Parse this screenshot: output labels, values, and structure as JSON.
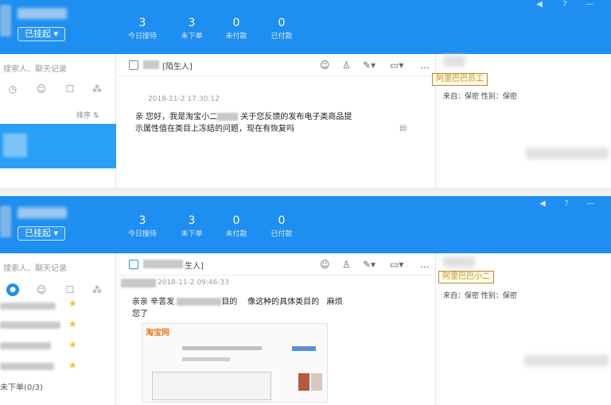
{
  "panels": [
    {
      "header": {
        "status_label": "已挂起 ▾",
        "stats": [
          {
            "value": "3",
            "label": "今日接待"
          },
          {
            "value": "3",
            "label": "未下单"
          },
          {
            "value": "0",
            "label": "未付款"
          },
          {
            "value": "0",
            "label": "已付款"
          }
        ]
      },
      "sidebar": {
        "search_placeholder": "搜索人、聊天记录",
        "sort_label": "排序 ⇅"
      },
      "chat": {
        "contact_tag": "陌生人",
        "message": {
          "time": "2018-11-2 17:30:12",
          "line1_a": "亲  您好，我是淘宝小二",
          "line1_b": "关于您反馈的发布电子类商品提",
          "line2": "示属性值在类目上冻结的问题，现在有恢复吗"
        }
      },
      "profile": {
        "nickname": "阿里巴巴员工",
        "info": "来自：保密   性别：保密"
      }
    },
    {
      "header": {
        "status_label": "已挂起 ▾",
        "stats": [
          {
            "value": "3",
            "label": "今日接待"
          },
          {
            "value": "3",
            "label": "未下单"
          },
          {
            "value": "0",
            "label": "未付款"
          },
          {
            "value": "0",
            "label": "已付款"
          }
        ]
      },
      "sidebar": {
        "search_placeholder": "搜索人、聊天记录",
        "order_label": "未下单(0/3)"
      },
      "chat": {
        "contact_tag": "生人",
        "message": {
          "time": "2018-11-2 09:46:33",
          "line1_a": "亲亲  辛苦发",
          "line1_b": "目的",
          "line1_c": "像这种的具体类目的",
          "line1_d": "麻烦",
          "line2": "您了",
          "screenshot_caption": "淘宝网"
        }
      },
      "profile": {
        "nickname": "阿里巴巴小二",
        "info": "来自：保密   性别：保密"
      }
    }
  ]
}
